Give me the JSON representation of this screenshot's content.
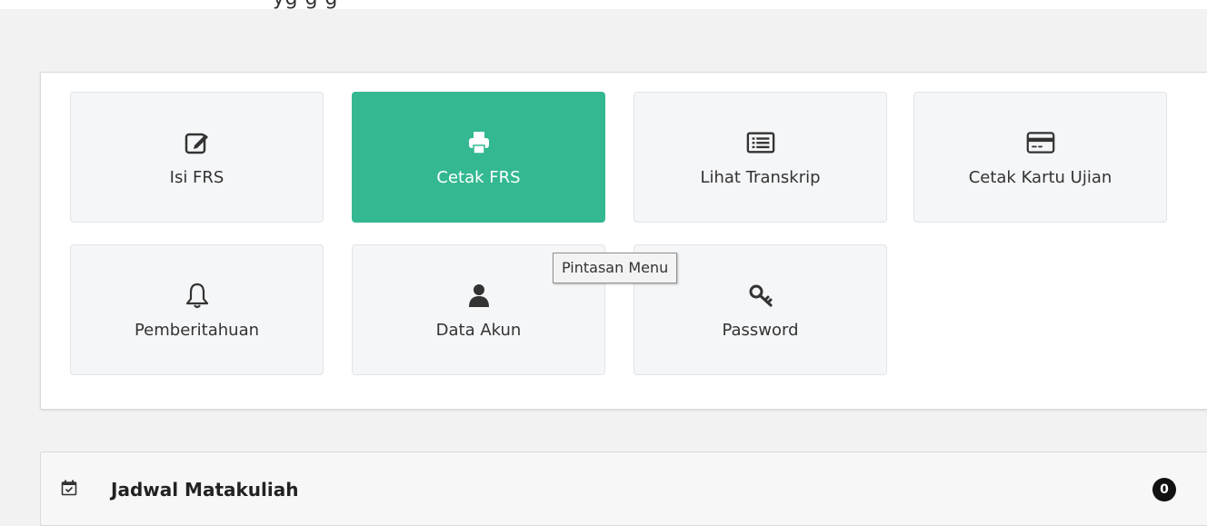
{
  "header": {
    "truncated_text": "yg   g   g"
  },
  "menu": {
    "tiles": [
      {
        "label": "Isi FRS",
        "icon": "edit-icon",
        "active": false
      },
      {
        "label": "Cetak FRS",
        "icon": "print-icon",
        "active": true
      },
      {
        "label": "Lihat Transkrip",
        "icon": "list-icon",
        "active": false
      },
      {
        "label": "Cetak Kartu Ujian",
        "icon": "credit-card-icon",
        "active": false
      },
      {
        "label": "Pemberitahuan",
        "icon": "bell-icon",
        "active": false
      },
      {
        "label": "Data Akun",
        "icon": "user-icon",
        "active": false
      },
      {
        "label": "Password",
        "icon": "key-icon",
        "active": false
      }
    ],
    "tooltip": "Pintasan Menu"
  },
  "schedule": {
    "title": "Jadwal Matakuliah",
    "count": "0",
    "icon": "calendar-check-icon"
  },
  "colors": {
    "accent": "#33b891",
    "tile_bg": "#f5f6f8",
    "page_bg": "#f2f2f2"
  }
}
